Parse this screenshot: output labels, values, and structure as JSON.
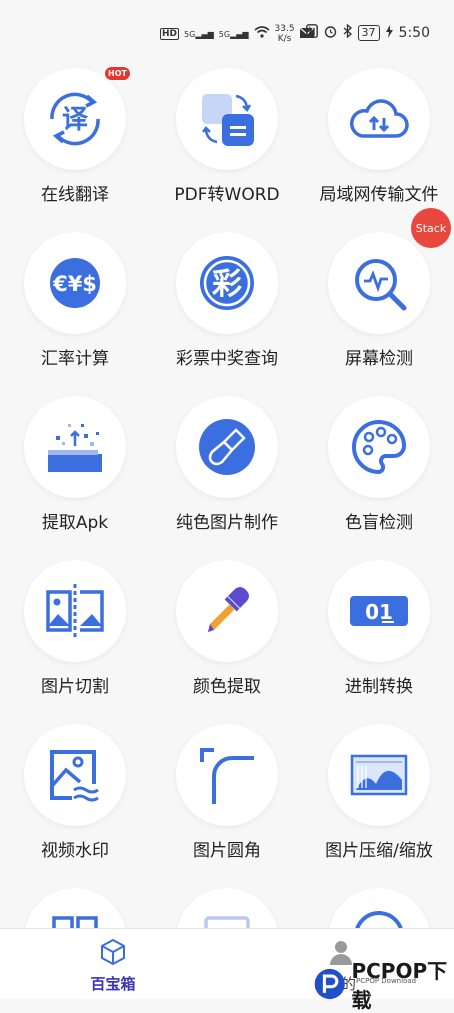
{
  "status_bar": {
    "hd": "HD",
    "signal1": "5G",
    "signal2": "5G",
    "net_speed_value": "33.5",
    "net_speed_unit": "K/s",
    "battery": "37",
    "time": "5:50"
  },
  "colors": {
    "accent": "#3b6fe0",
    "active_nav": "#3a34b8",
    "badge": "#e8362d"
  },
  "tools": [
    {
      "label": "在线翻译",
      "icon": "translate-icon",
      "badge": "HOT"
    },
    {
      "label": "PDF转WORD",
      "icon": "pdf-word-icon"
    },
    {
      "label": "局域网传输文件",
      "icon": "cloud-transfer-icon"
    },
    {
      "label": "汇率计算",
      "icon": "currency-icon"
    },
    {
      "label": "彩票中奖查询",
      "icon": "lottery-icon",
      "icon_text": "彩"
    },
    {
      "label": "屏幕检测",
      "icon": "screen-check-icon"
    },
    {
      "label": "提取Apk",
      "icon": "extract-apk-icon"
    },
    {
      "label": "纯色图片制作",
      "icon": "brush-icon"
    },
    {
      "label": "色盲检测",
      "icon": "palette-icon"
    },
    {
      "label": "图片切割",
      "icon": "image-cut-icon"
    },
    {
      "label": "颜色提取",
      "icon": "eyedropper-icon"
    },
    {
      "label": "进制转换",
      "icon": "binary-icon",
      "icon_text": "01"
    },
    {
      "label": "视频水印",
      "icon": "video-watermark-icon"
    },
    {
      "label": "图片圆角",
      "icon": "round-corner-icon"
    },
    {
      "label": "图片压缩/缩放",
      "icon": "image-compress-icon"
    }
  ],
  "stack_badge": "Stack",
  "bottom_nav": {
    "items": [
      {
        "label": "百宝箱",
        "icon": "cube-icon",
        "active": true
      },
      {
        "label": "我的",
        "icon": "user-icon",
        "active": false
      }
    ]
  },
  "watermark": {
    "text": "PCPOP下载",
    "sub": "PCPOP Download"
  }
}
